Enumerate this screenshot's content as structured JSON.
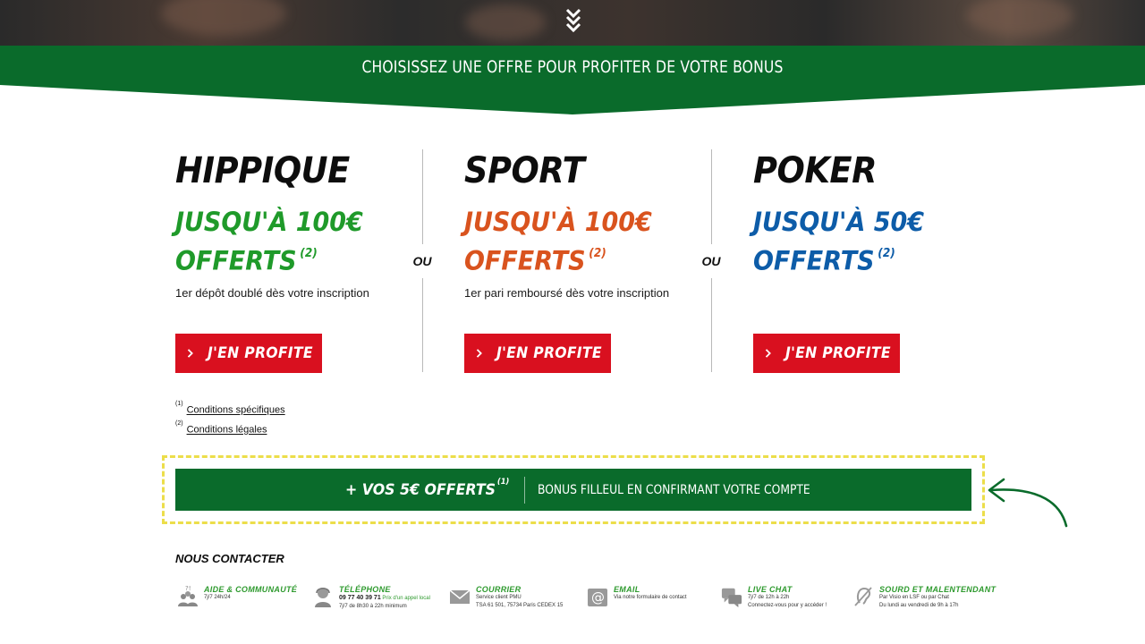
{
  "banner": {
    "title": "CHOISISSEZ UNE OFFRE POUR PROFITER DE VOTRE BONUS"
  },
  "offers": [
    {
      "name": "HIPPIQUE",
      "amount_line1": "JUSQU'À 100€",
      "amount_line2": "OFFERTS",
      "note_ref": "(2)",
      "description": "1er dépôt doublé dès votre inscription",
      "cta_label": "J'EN PROFITE",
      "color": "#1f9a2a"
    },
    {
      "name": "SPORT",
      "amount_line1": "JUSQU'À 100€",
      "amount_line2": "OFFERTS",
      "note_ref": "(2)",
      "description": "1er pari remboursé dès votre inscription",
      "cta_label": "J'EN PROFITE",
      "color": "#d9531e"
    },
    {
      "name": "POKER",
      "amount_line1": "JUSQU'À 50€",
      "amount_line2": "OFFERTS",
      "note_ref": "(2)",
      "description": "",
      "cta_label": "J'EN PROFITE",
      "color": "#0d5ca8"
    }
  ],
  "separator_label": "OU",
  "conditions": [
    {
      "ref": "(1)",
      "label": "Conditions spécifiques"
    },
    {
      "ref": "(2)",
      "label": "Conditions légales"
    }
  ],
  "filleul": {
    "main": "+ VOS 5€ OFFERTS",
    "ref": "(1)",
    "sub": "BONUS FILLEUL EN CONFIRMANT VOTRE COMPTE"
  },
  "contact": {
    "title": "NOUS CONTACTER",
    "items": [
      {
        "icon": "community-icon",
        "title": "AIDE & COMMUNAUTÉ",
        "line1": "7j/7 24h/24",
        "line2": ""
      },
      {
        "icon": "phone-agent-icon",
        "title": "TÉLÉPHONE",
        "line1": "09 77 40 39 71",
        "line1_note": "Prix d'un appel local",
        "line2": "7j/7 de 8h30 à 22h minimum"
      },
      {
        "icon": "envelope-icon",
        "title": "COURRIER",
        "line1": "Service client PMU",
        "line2": "TSA 61 501, 75734 Paris CEDEX 15"
      },
      {
        "icon": "at-sign-icon",
        "title": "EMAIL",
        "line1": "Via notre formulaire de contact",
        "line2": ""
      },
      {
        "icon": "chat-bubbles-icon",
        "title": "LIVE CHAT",
        "line1": "7j/7 de 12h à 22h",
        "line2": "Connectez-vous pour y accéder !"
      },
      {
        "icon": "hearing-impaired-icon",
        "title": "SOURD ET MALENTENDANT",
        "line1": "Par Visio en LSF ou par Chat",
        "line2": "Du lundi au vendredi de 9h à 17h"
      }
    ]
  },
  "colors": {
    "brand_green": "#0a6b2b",
    "cta_red": "#d9101f",
    "highlight_yellow": "#ecde4a",
    "contact_green": "#2e9a2e"
  }
}
